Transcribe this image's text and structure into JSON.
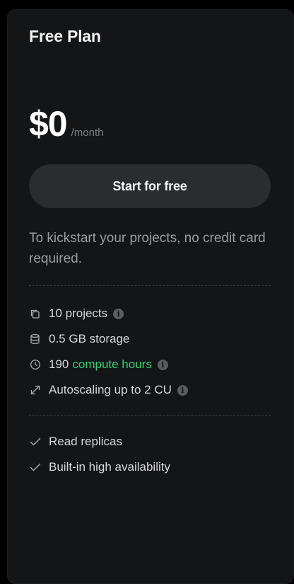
{
  "plan": {
    "name": "Free Plan",
    "price": "$0",
    "period": "/month",
    "cta_label": "Start for free",
    "description": "To kickstart your projects, no credit card required."
  },
  "features": [
    {
      "icon": "copy-icon",
      "text": "10 projects",
      "info": true
    },
    {
      "icon": "database-icon",
      "text": "0.5 GB storage",
      "info": false
    },
    {
      "icon": "clock-icon",
      "prefix": "190",
      "highlight": "compute hours",
      "info": true
    },
    {
      "icon": "expand-arrows-icon",
      "text": "Autoscaling up to 2 CU",
      "info": true
    }
  ],
  "extras": [
    {
      "icon": "check-icon",
      "text": "Read replicas"
    },
    {
      "icon": "check-icon",
      "text": "Built-in high availability"
    }
  ],
  "colors": {
    "accent_green": "#2dd575",
    "card_background": "#141517",
    "button_background": "#2b2c2f"
  },
  "info_glyph": "i"
}
